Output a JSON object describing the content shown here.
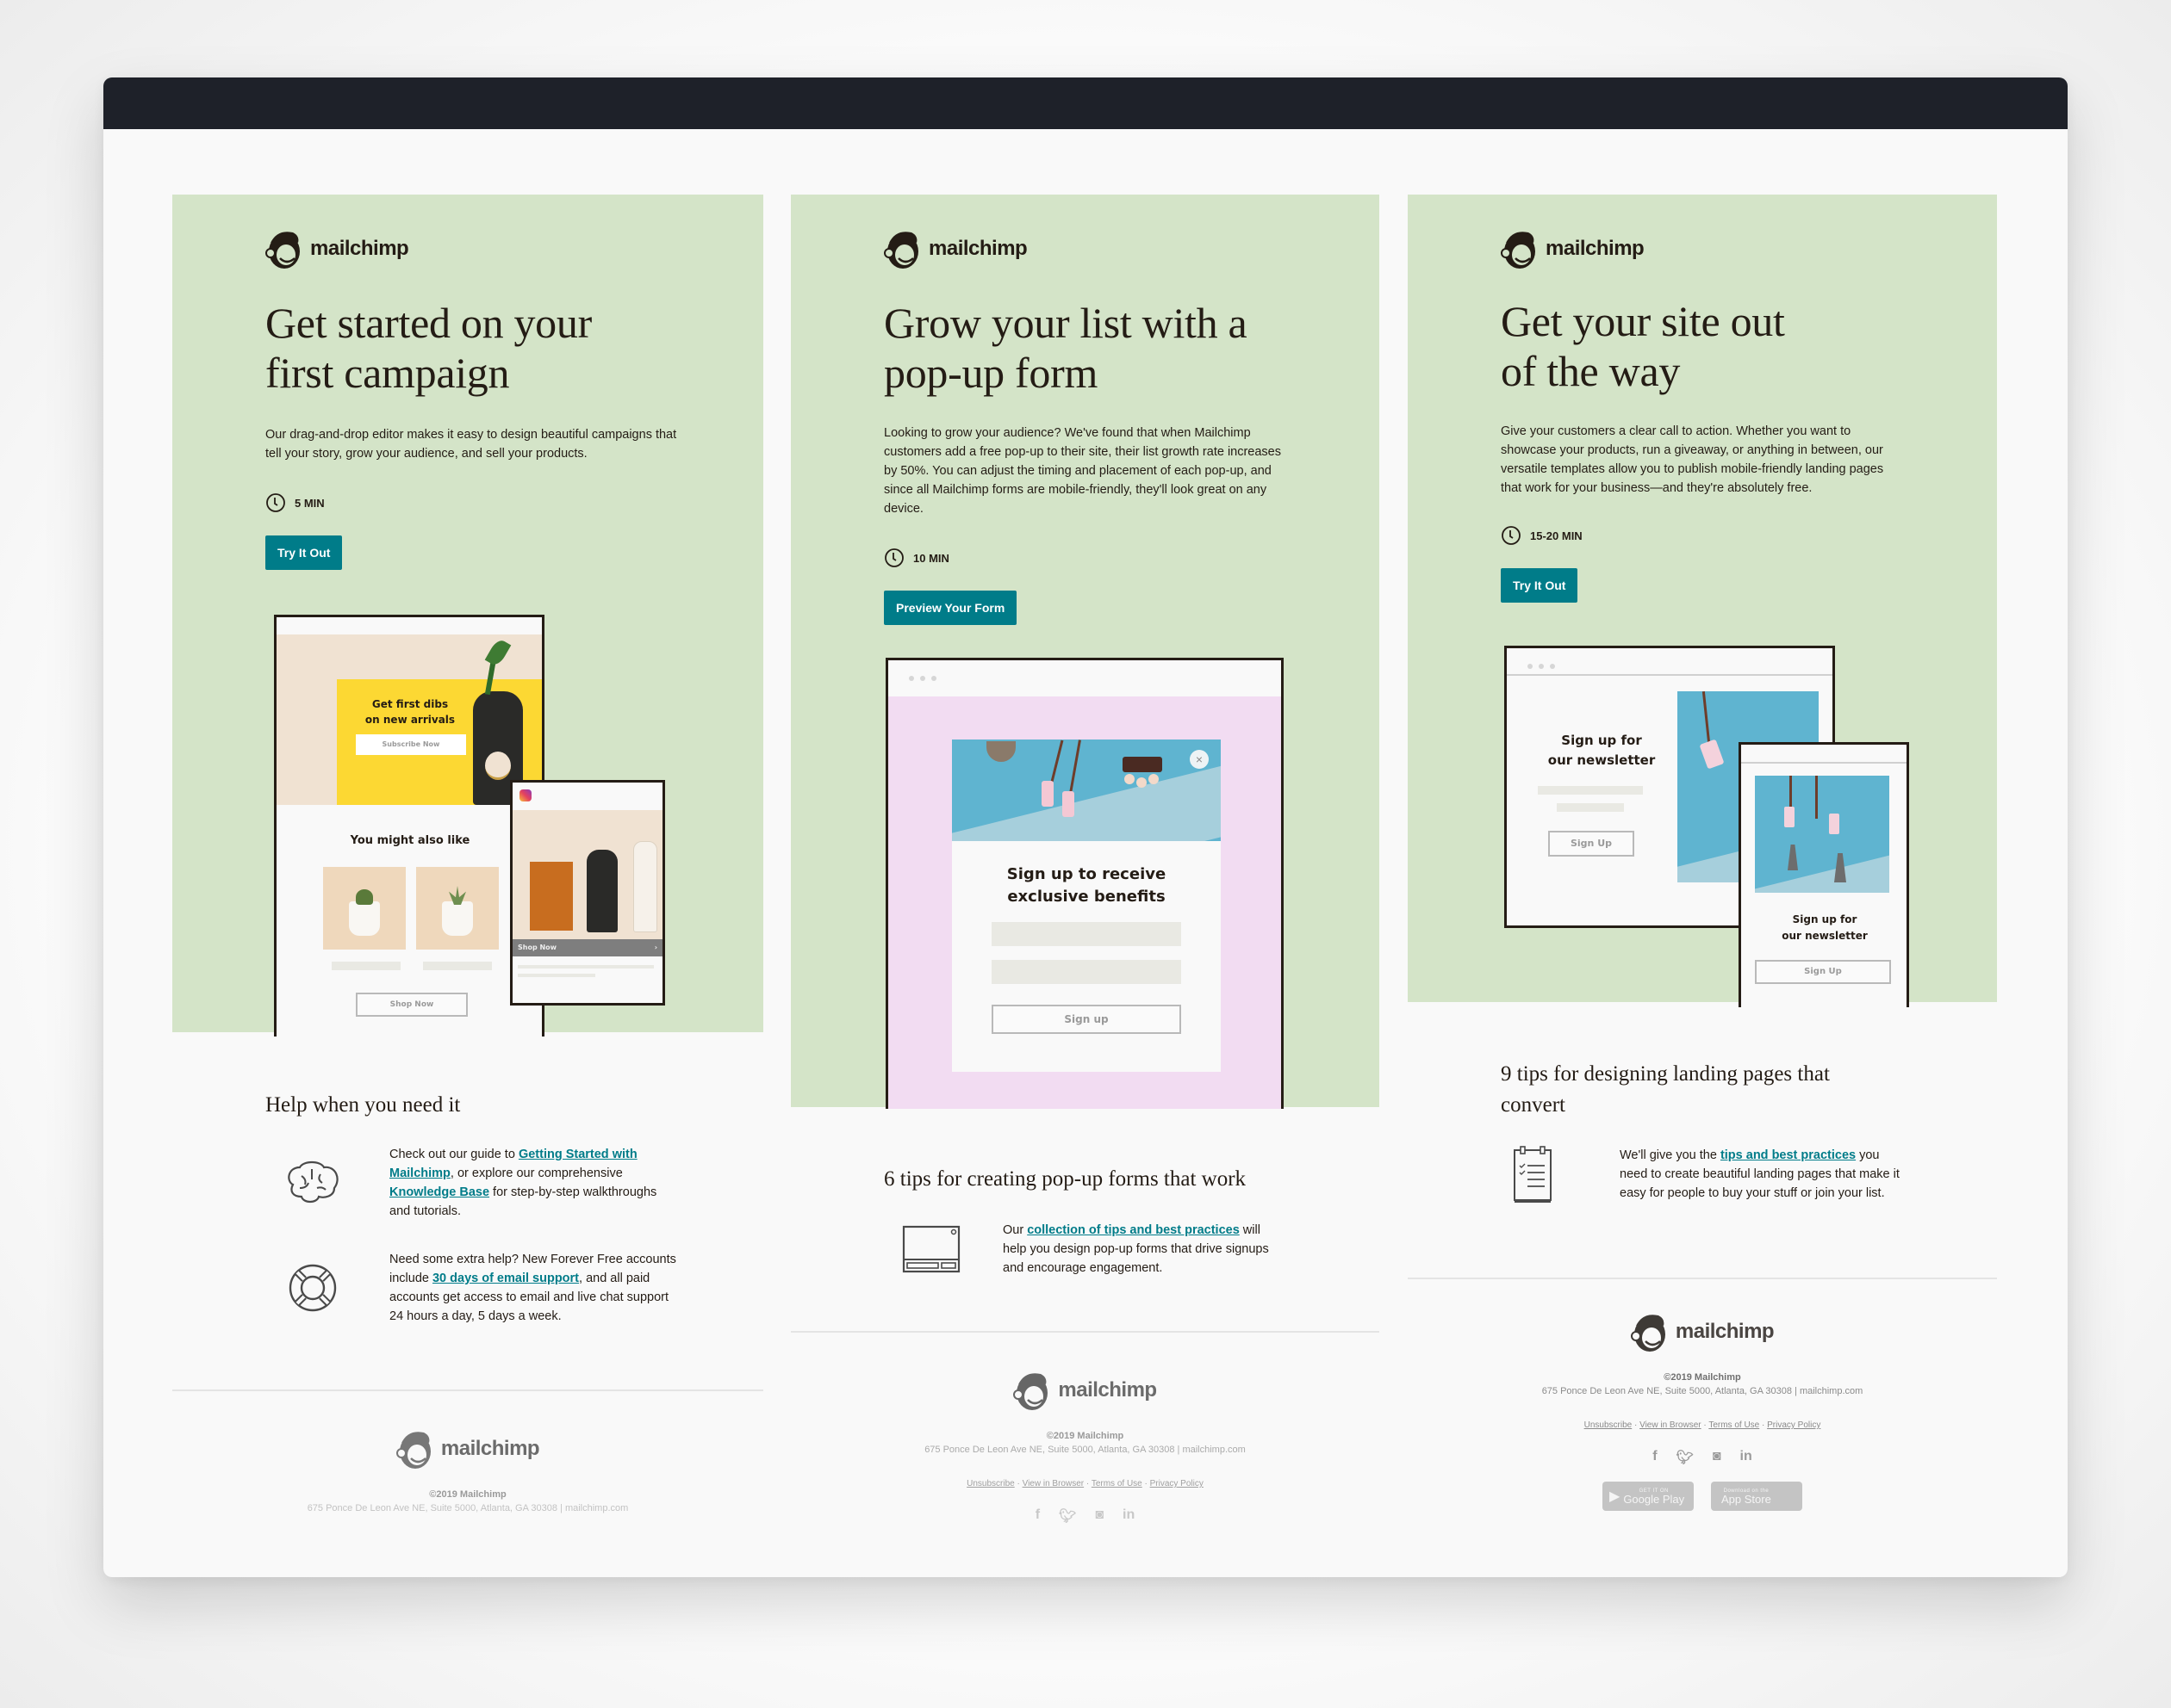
{
  "columns": [
    {
      "logo_text": "mailchimp",
      "title_line1": "Get started on your",
      "title_line2": "first campaign",
      "description": "Our drag-and-drop editor makes it easy to design beautiful campaigns that tell your story, grow your audience, and sell your products.",
      "time": "5 MIN",
      "cta_label": "Try It Out",
      "illustration": {
        "hero_line1": "Get first dibs",
        "hero_line2": "on new arrivals",
        "subscribe_label": "Subscribe Now",
        "section_title": "You might also like",
        "shop_label": "Shop Now",
        "mobile_shop_label": "Shop Now"
      },
      "section_title": "Help when you need it",
      "rows": [
        {
          "icon": "brain-icon",
          "pre": "Check out our guide to ",
          "link1": "Getting Started with Mailchimp",
          "mid": ", or explore our comprehensive ",
          "link2": "Knowledge Base",
          "post": " for step-by-step walkthroughs and tutorials."
        },
        {
          "icon": "lifebuoy-icon",
          "pre": "Need some extra help? New Forever Free accounts include ",
          "link1": "30 days of email support",
          "post": ", and all paid accounts get access to email and live chat support 24 hours a day, 5 days a week."
        }
      ],
      "footer": {
        "logo_text": "mailchimp",
        "copyright": "©2019 Mailchimp",
        "address": "675 Ponce De Leon Ave NE, Suite 5000, Atlanta, GA 30308 | mailchimp.com"
      }
    },
    {
      "logo_text": "mailchimp",
      "title_line1": "Grow your list with a",
      "title_line2": "pop-up form",
      "description": "Looking to grow your audience? We've found that when Mailchimp customers add a free pop-up to their site, their list growth rate increases by 50%. You can adjust the timing and placement of each pop-up, and since all Mailchimp forms are mobile-friendly, they'll look great on any device.",
      "time": "10 MIN",
      "cta_label": "Preview Your Form",
      "illustration": {
        "popup_title_line1": "Sign up to receive",
        "popup_title_line2": "exclusive benefits",
        "signup_label": "Sign up"
      },
      "section_title": "6 tips for creating pop-up forms that work",
      "rows": [
        {
          "icon": "popup-window-icon",
          "pre": "Our ",
          "link1": "collection of tips and best practices",
          "post": " will help you design pop-up forms that drive signups and encourage engagement."
        }
      ],
      "footer": {
        "logo_text": "mailchimp",
        "copyright": "©2019 Mailchimp",
        "address": "675 Ponce De Leon Ave NE, Suite 5000, Atlanta, GA 30308 | mailchimp.com",
        "links": [
          "Unsubscribe",
          "View in Browser",
          "Terms of Use",
          "Privacy Policy"
        ],
        "social": [
          "f",
          "twitter",
          "instagram",
          "in"
        ]
      }
    },
    {
      "logo_text": "mailchimp",
      "title_line1": "Get your site out",
      "title_line2": "of the way",
      "description": "Give your customers a clear call to action. Whether you want to showcase your products, run a giveaway, or anything in between, our versatile templates allow you to publish mobile-friendly landing pages that work for your business—and they're absolutely free.",
      "time": "15-20 MIN",
      "cta_label": "Try It Out",
      "illustration": {
        "desktop_title_line1": "Sign up for",
        "desktop_title_line2": "our newsletter",
        "desktop_signup": "Sign Up",
        "mobile_title_line1": "Sign up for",
        "mobile_title_line2": "our newsletter",
        "mobile_signup": "Sign Up"
      },
      "section_title": "9 tips for designing landing pages that convert",
      "rows": [
        {
          "icon": "checklist-icon",
          "pre": "We'll give you the ",
          "link1": "tips and best practices",
          "post": " you need to create beautiful landing pages that make it easy for people to buy your stuff or join your list."
        }
      ],
      "footer": {
        "logo_text": "mailchimp",
        "copyright": "©2019 Mailchimp",
        "address": "675 Ponce De Leon Ave NE, Suite 5000, Atlanta, GA 30308 | mailchimp.com",
        "links": [
          "Unsubscribe",
          "View in Browser",
          "Terms of Use",
          "Privacy Policy"
        ],
        "social": [
          "f",
          "twitter",
          "instagram",
          "in"
        ],
        "stores": [
          {
            "small": "GET IT ON",
            "big": "Google Play"
          },
          {
            "small": "Download on the",
            "big": "App Store"
          }
        ]
      }
    }
  ],
  "colors": {
    "hero_bg": "#d4e4c8",
    "accent": "#007c89",
    "topbar": "#1e2129",
    "popup_bg": "#f2dcf2",
    "photo_blue": "#5fb4d0",
    "yellow": "#fcd833"
  }
}
